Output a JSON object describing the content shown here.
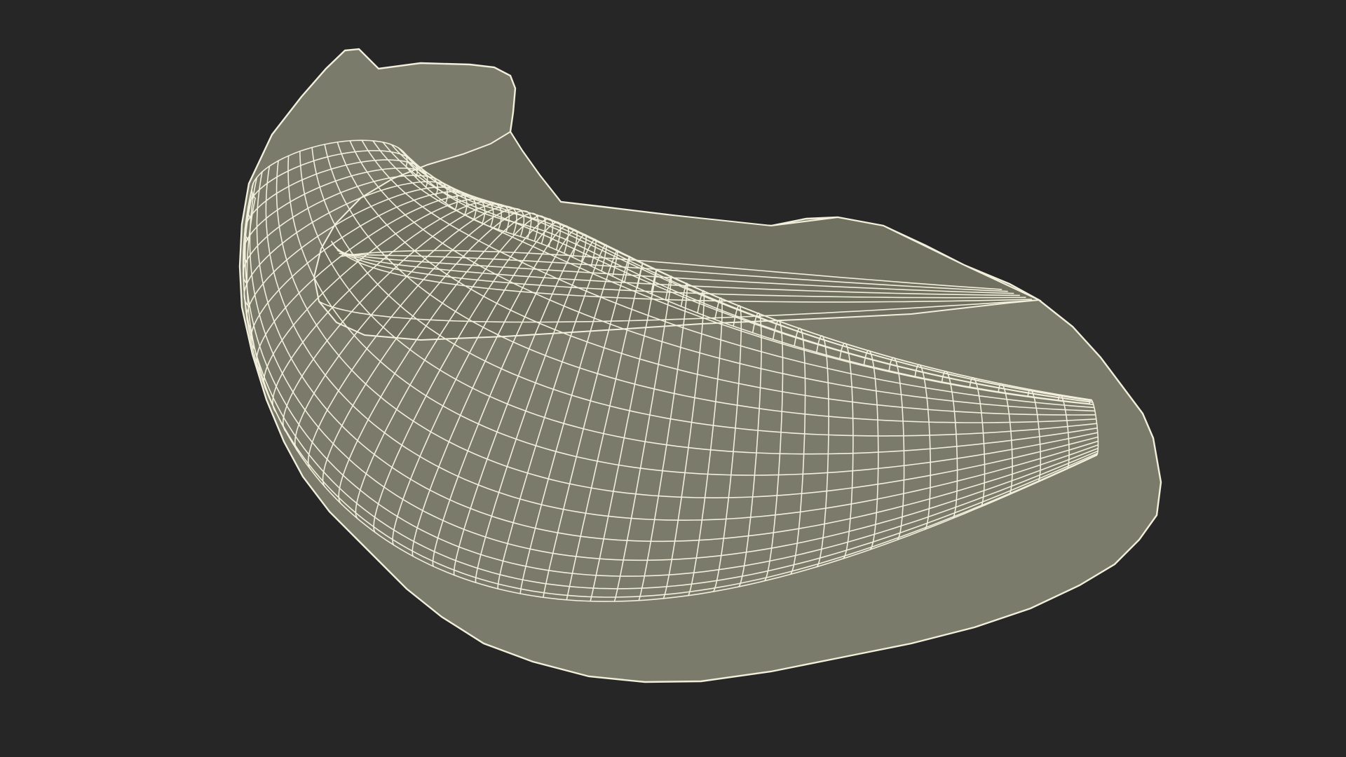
{
  "scene": {
    "background_color": "#262626",
    "mesh_color": "#7a7b6a",
    "mesh_shade_color": "#6f705f",
    "wire_color": "#f2efdc",
    "render_style": "wireframe-over-shaded"
  }
}
